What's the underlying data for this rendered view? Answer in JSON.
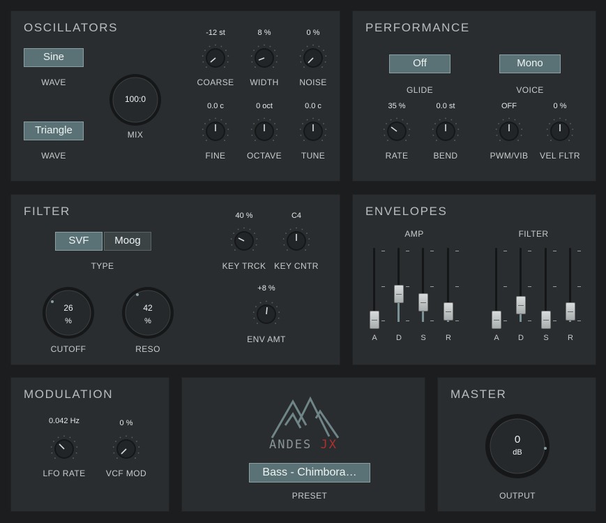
{
  "oscillators": {
    "title": "OSCILLATORS",
    "wave1": {
      "button": "Sine",
      "label": "WAVE"
    },
    "wave2": {
      "button": "Triangle",
      "label": "WAVE"
    },
    "mix": {
      "value": "100:0",
      "label": "MIX"
    },
    "knobs": [
      {
        "id": "coarse",
        "label": "COARSE",
        "value": "-12 st"
      },
      {
        "id": "width",
        "label": "WIDTH",
        "value": "8 %"
      },
      {
        "id": "noise",
        "label": "NOISE",
        "value": "0 %"
      },
      {
        "id": "fine",
        "label": "FINE",
        "value": "0.0 c"
      },
      {
        "id": "octave",
        "label": "OCTAVE",
        "value": "0 oct"
      },
      {
        "id": "tune",
        "label": "TUNE",
        "value": "0.0 c"
      }
    ]
  },
  "performance": {
    "title": "PERFORMANCE",
    "glide": {
      "button": "Off",
      "label": "GLIDE"
    },
    "voice": {
      "button": "Mono",
      "label": "VOICE"
    },
    "knobs": [
      {
        "id": "rate",
        "label": "RATE",
        "value": "35 %"
      },
      {
        "id": "bend",
        "label": "BEND",
        "value": "0.0 st"
      },
      {
        "id": "pwmvib",
        "label": "PWM/VIB",
        "value": "OFF"
      },
      {
        "id": "velfltr",
        "label": "VEL FLTR",
        "value": "0 %"
      }
    ]
  },
  "filter": {
    "title": "FILTER",
    "type_buttons": [
      "SVF",
      "Moog"
    ],
    "type_label": "TYPE",
    "cutoff": {
      "value": "26",
      "unit": "%",
      "label": "CUTOFF"
    },
    "reso": {
      "value": "42",
      "unit": "%",
      "label": "RESO"
    },
    "knobs": [
      {
        "id": "keytrck",
        "label": "KEY TRCK",
        "value": "40 %"
      },
      {
        "id": "keycntr",
        "label": "KEY CNTR",
        "value": "C4"
      },
      {
        "id": "envamt",
        "label": "ENV AMT",
        "value": "+8 %"
      }
    ]
  },
  "envelopes": {
    "title": "ENVELOPES",
    "amp_label": "AMP",
    "filter_label": "FILTER",
    "fader_labels": [
      "A",
      "D",
      "S",
      "R"
    ]
  },
  "modulation": {
    "title": "MODULATION",
    "knobs": [
      {
        "id": "lforate",
        "label": "LFO RATE",
        "value": "0.042 Hz"
      },
      {
        "id": "vcfmod",
        "label": "VCF MOD",
        "value": "0 %"
      }
    ]
  },
  "logo": {
    "text_main": "ANDES",
    "text_accent": "JX"
  },
  "preset": {
    "name": "Bass - Chimbora…",
    "label": "PRESET"
  },
  "master": {
    "title": "MASTER",
    "output": {
      "value": "0",
      "unit": "dB",
      "label": "OUTPUT"
    }
  },
  "colors": {
    "accent": "#5a7275",
    "panel": "#2a2d2f",
    "background": "#1b1d1e",
    "logo_accent": "#b03030"
  }
}
